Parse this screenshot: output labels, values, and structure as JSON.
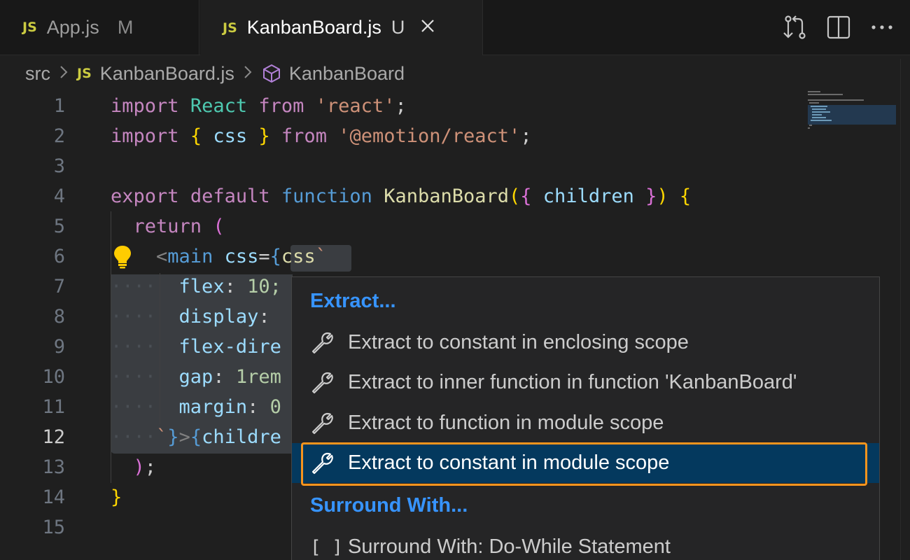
{
  "tabs": [
    {
      "icon": "JS",
      "label": "App.js",
      "status": "M"
    },
    {
      "icon": "JS",
      "label": "KanbanBoard.js",
      "status": "U"
    }
  ],
  "breadcrumb": {
    "folder": "src",
    "file_icon": "JS",
    "file": "KanbanBoard.js",
    "symbol": "KanbanBoard"
  },
  "line_numbers": [
    "1",
    "2",
    "3",
    "4",
    "5",
    "6",
    "7",
    "8",
    "9",
    "10",
    "11",
    "12",
    "13",
    "14",
    "15"
  ],
  "active_line": "12",
  "code": {
    "l1": {
      "kw": "import",
      "ident": "React",
      "from": "from",
      "str": "'react'",
      "end": ";"
    },
    "l2": {
      "kw": "import",
      "ob": "{",
      "ident": "css",
      "cb": "}",
      "from": "from",
      "str": "'@emotion/react'",
      "end": ";"
    },
    "l4": {
      "kw1": "export",
      "kw2": "default",
      "kw3": "function",
      "name": "KanbanBoard",
      "op": "(",
      "ob": "{",
      "param": "children",
      "cb": "}",
      "cp": ")",
      "body": "{"
    },
    "l5": {
      "kw": "return",
      "op": "("
    },
    "l6": {
      "lt": "<",
      "tag": "main",
      "attr": "css",
      "eq": "=",
      "ob": "{",
      "fn": "css",
      "tick": "`"
    },
    "l7": {
      "prop": "flex",
      "colon": ":",
      "val": "10;"
    },
    "l8": {
      "prop": "display",
      "colon": ":"
    },
    "l9": {
      "prop": "flex-dire"
    },
    "l10": {
      "prop": "gap",
      "colon": ":",
      "val": "1rem"
    },
    "l11": {
      "prop": "margin",
      "colon": ":",
      "val": "0"
    },
    "l12": {
      "tick": "`",
      "cb": "}",
      "gt": ">",
      "ob": "{",
      "ident": "childre"
    },
    "l13": {
      "cp": ")",
      "end": ";"
    },
    "l14": {
      "cb": "}"
    }
  },
  "menu": {
    "extract_header": "Extract...",
    "extract_items": [
      "Extract to constant in enclosing scope",
      "Extract to inner function in function 'KanbanBoard'",
      "Extract to function in module scope",
      "Extract to constant in module scope"
    ],
    "surround_header": "Surround With...",
    "surround_items": [
      {
        "icon": "[ ]",
        "label": "Surround With: Do-While Statement"
      }
    ]
  },
  "colors": {
    "accent": "#3794ff",
    "selection": "#04395e",
    "focus_outline": "#f7941d",
    "js_icon": "#cbcb41"
  },
  "icons": [
    "compare-changes-icon",
    "split-editor-icon",
    "more-actions-icon",
    "close-icon",
    "symbol-class-icon",
    "lightbulb-icon",
    "wrench-icon"
  ]
}
